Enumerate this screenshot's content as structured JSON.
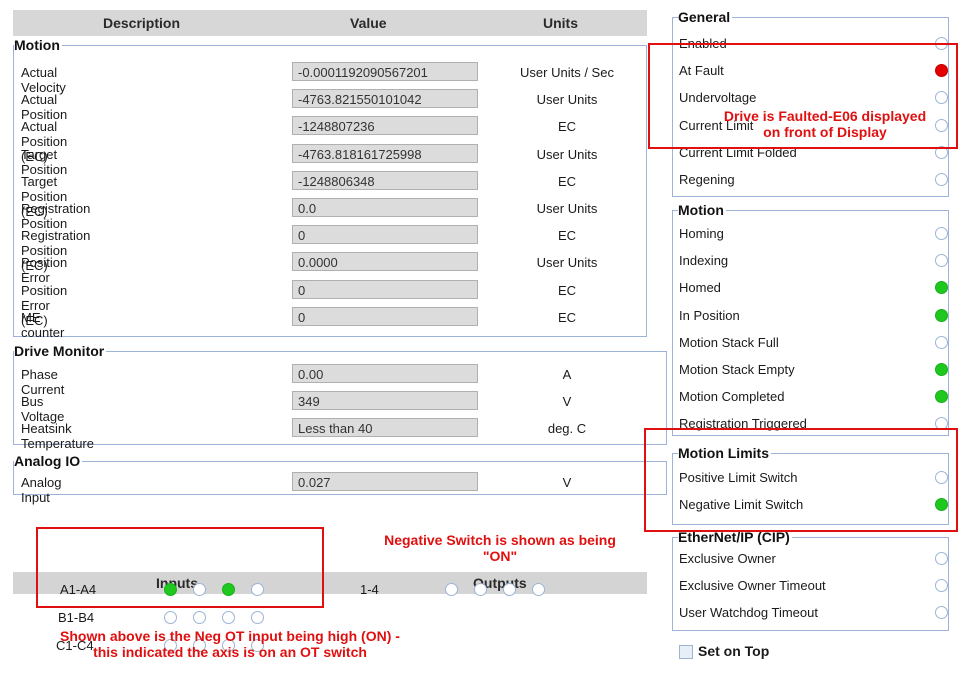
{
  "table_header": {
    "description": "Description",
    "value": "Value",
    "units": "Units"
  },
  "motion": {
    "title": "Motion",
    "rows": [
      {
        "label": "Actual Velocity",
        "value": "-0.0001192090567201",
        "unit": "User Units / Sec"
      },
      {
        "label": "Actual Position",
        "value": "-4763.821550101042",
        "unit": "User Units"
      },
      {
        "label": "Actual Position (EC)",
        "value": "-1248807236",
        "unit": "EC"
      },
      {
        "label": "Target Position",
        "value": "-4763.818161725998",
        "unit": "User Units"
      },
      {
        "label": "Target Position (EC)",
        "value": "-1248806348",
        "unit": "EC"
      },
      {
        "label": "Registration Position",
        "value": "0.0",
        "unit": "User Units"
      },
      {
        "label": "Registration Position (EC)",
        "value": "0",
        "unit": "EC"
      },
      {
        "label": "Position Error",
        "value": "0.0000",
        "unit": "User Units"
      },
      {
        "label": "Position Error (EC)",
        "value": "0",
        "unit": "EC"
      },
      {
        "label": "ME counter",
        "value": "0",
        "unit": "EC"
      }
    ]
  },
  "drive_monitor": {
    "title": "Drive Monitor",
    "rows": [
      {
        "label": "Phase Current",
        "value": "0.00",
        "unit": "A"
      },
      {
        "label": "Bus Voltage",
        "value": "349",
        "unit": "V"
      },
      {
        "label": "Heatsink Temperature",
        "value": "Less than 40",
        "unit": "deg. C"
      }
    ]
  },
  "analog_io": {
    "title": "Analog IO",
    "rows": [
      {
        "label": "Analog Input",
        "value": "0.027",
        "unit": "V"
      }
    ]
  },
  "io": {
    "inputs_title": "Inputs",
    "outputs_title": "Outputs",
    "input_rows": [
      {
        "label": "A1-A4",
        "states": [
          "on",
          "off",
          "on",
          "off"
        ]
      },
      {
        "label": "B1-B4",
        "states": [
          "off",
          "off",
          "off",
          "off"
        ]
      },
      {
        "label": "C1-C4",
        "states": [
          "off",
          "off",
          "off",
          "off"
        ]
      }
    ],
    "output_rows": [
      {
        "label": "1-4",
        "states": [
          "off",
          "off",
          "off",
          "off"
        ]
      }
    ]
  },
  "status": {
    "general": {
      "title": "General",
      "items": [
        {
          "label": "Enabled",
          "state": "off"
        },
        {
          "label": "At Fault",
          "state": "red"
        },
        {
          "label": "Undervoltage",
          "state": "off"
        },
        {
          "label": "Current Limit",
          "state": "off"
        },
        {
          "label": "Current Limit Folded",
          "state": "off"
        },
        {
          "label": "Regening",
          "state": "off"
        }
      ]
    },
    "motion": {
      "title": "Motion",
      "items": [
        {
          "label": "Homing",
          "state": "off"
        },
        {
          "label": "Indexing",
          "state": "off"
        },
        {
          "label": "Homed",
          "state": "green"
        },
        {
          "label": "In Position",
          "state": "green"
        },
        {
          "label": "Motion Stack Full",
          "state": "off"
        },
        {
          "label": "Motion Stack Empty",
          "state": "green"
        },
        {
          "label": "Motion Completed",
          "state": "green"
        },
        {
          "label": "Registration Triggered",
          "state": "off"
        }
      ]
    },
    "motion_limits": {
      "title": "Motion Limits",
      "items": [
        {
          "label": "Positive Limit Switch",
          "state": "off"
        },
        {
          "label": "Negative Limit Switch",
          "state": "green"
        }
      ]
    },
    "ethernet_ip": {
      "title": "EtherNet/IP (CIP)",
      "items": [
        {
          "label": "Exclusive Owner",
          "state": "off"
        },
        {
          "label": "Exclusive Owner Timeout",
          "state": "off"
        },
        {
          "label": "User Watchdog Timeout",
          "state": "off"
        }
      ]
    },
    "set_on_top": "Set on Top"
  },
  "annotations": {
    "fault_line1": "Drive is Faulted-E06 displayed",
    "fault_line2": "on front of Display",
    "neg_switch_line1": "Negative Switch is shown as being",
    "neg_switch_line2": "\"ON\"",
    "input_line1": "Shown above is the Neg OT input being high (ON) -",
    "input_line2": "this indicated the axis is on an OT switch"
  },
  "colors": {
    "led_green": "#1ec81e",
    "led_red": "#e40000",
    "annotation_red": "#e01010",
    "group_border": "#9db4d8"
  }
}
